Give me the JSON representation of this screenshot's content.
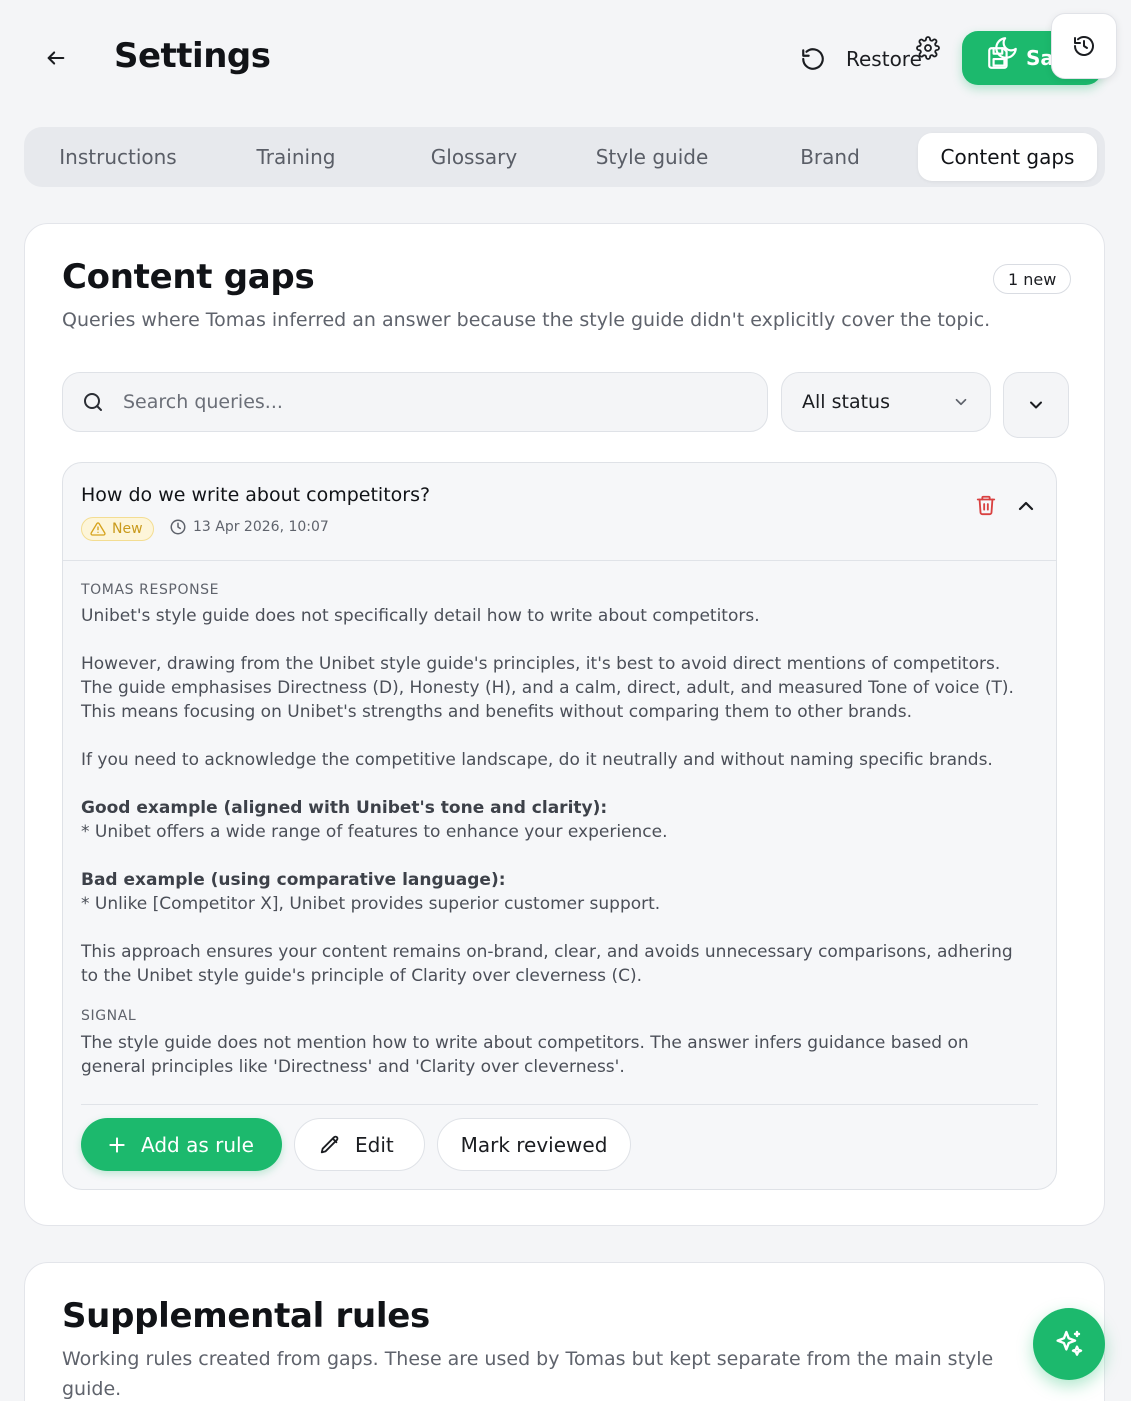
{
  "header": {
    "title": "Settings",
    "restore_label": "Restore",
    "save_label": "Sa"
  },
  "tabs": [
    {
      "label": "Instructions",
      "active": false
    },
    {
      "label": "Training",
      "active": false
    },
    {
      "label": "Glossary",
      "active": false
    },
    {
      "label": "Style guide",
      "active": false
    },
    {
      "label": "Brand",
      "active": false
    },
    {
      "label": "Content gaps",
      "active": true
    }
  ],
  "content_gaps": {
    "title": "Content gaps",
    "subtitle": "Queries where Tomas inferred an answer because the style guide didn't explicitly cover the topic.",
    "new_count_label": "1 new",
    "search_placeholder": "Search queries...",
    "status_filter": "All status",
    "items": [
      {
        "query": "How do we write about competitors?",
        "badge": "New",
        "date": "13 Apr 2026, 10:07",
        "response_label": "TOMAS RESPONSE",
        "response": {
          "p1": "Unibet's style guide does not specifically detail how to write about competitors.",
          "p2": "However, drawing from the Unibet style guide's principles, it's best to avoid direct mentions of competitors. The guide emphasises Directness (D), Honesty (H), and a calm, direct, adult, and measured Tone of voice (T). This means focusing on Unibet's strengths and benefits without comparing them to other brands.",
          "p3": "If you need to acknowledge the competitive landscape, do it neutrally and without naming specific brands.",
          "good_heading": "Good example (aligned with Unibet's tone and clarity):",
          "good_example": "* Unibet offers a wide range of features to enhance your experience.",
          "bad_heading": "Bad example (using comparative language):",
          "bad_example": "* Unlike [Competitor X], Unibet provides superior customer support.",
          "p4": "This approach ensures your content remains on-brand, clear, and avoids unnecessary comparisons, adhering to the Unibet style guide's principle of Clarity over cleverness (C)."
        },
        "signal_label": "SIGNAL",
        "signal": "The style guide does not mention how to write about competitors. The answer infers guidance based on general principles like 'Directness' and 'Clarity over cleverness'.",
        "actions": {
          "add_rule": "Add as rule",
          "edit": "Edit",
          "mark_reviewed": "Mark reviewed"
        }
      }
    ]
  },
  "supplemental_rules": {
    "title": "Supplemental rules",
    "subtitle": "Working rules created from gaps. These are used by Tomas but kept separate from the main style guide."
  },
  "colors": {
    "accent": "#1cb96d",
    "danger": "#d94141",
    "warning_bg": "#fdf5d9",
    "warning_fg": "#c99a1c",
    "page_bg": "#f4f5f7"
  },
  "icons": [
    "arrow-left-icon",
    "restore-icon",
    "gear-icon",
    "save-icon",
    "moon-icon",
    "history-icon",
    "search-icon",
    "chevron-down-icon",
    "chevron-up-icon",
    "trash-icon",
    "warning-icon",
    "clock-icon",
    "plus-icon",
    "pencil-icon",
    "sparkles-icon"
  ]
}
